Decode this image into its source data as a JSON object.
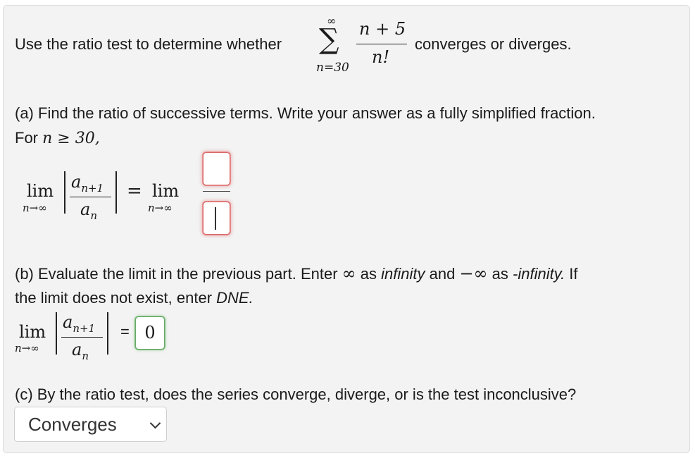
{
  "question": {
    "intro": "Use the ratio test to determine whether",
    "sum_upper": "∞",
    "sum_symbol": "∑",
    "sum_lower": "n=30",
    "term_numerator": "n + 5",
    "term_denominator": "n!",
    "outro": "converges or diverges."
  },
  "part_a": {
    "line1": "(a) Find the ratio of successive terms. Write your answer as a fully simplified fraction.",
    "line2_prefix": "For ",
    "line2_condition": "n ≥ 30,",
    "lim_word": "lim",
    "lim_sub": "n→∞",
    "ratio_numerator": "a",
    "ratio_numerator_sub": "n+1",
    "ratio_denominator": "a",
    "ratio_denominator_sub": "n",
    "equals": "=",
    "numerator_value": "",
    "denominator_value": ""
  },
  "part_b": {
    "line1_start": "(b) Evaluate the limit in the previous part. Enter ",
    "infinity_symbol": "∞",
    "line1_as1": " as ",
    "infinity_word": "infinity",
    "line1_and": " and ",
    "neg_infinity_symbol": "−∞",
    "line1_as2": " as ",
    "neg_infinity_word": "-infinity.",
    "line1_end": " If",
    "line2_start": "the limit does not exist, enter ",
    "dne_word": "DNE.",
    "lim_word": "lim",
    "lim_sub": "n→∞",
    "equals": "=",
    "answer_value": "0"
  },
  "part_c": {
    "question": "(c) By the ratio test, does the series converge, diverge, or is the test inconclusive?",
    "selected_option": "Converges"
  }
}
